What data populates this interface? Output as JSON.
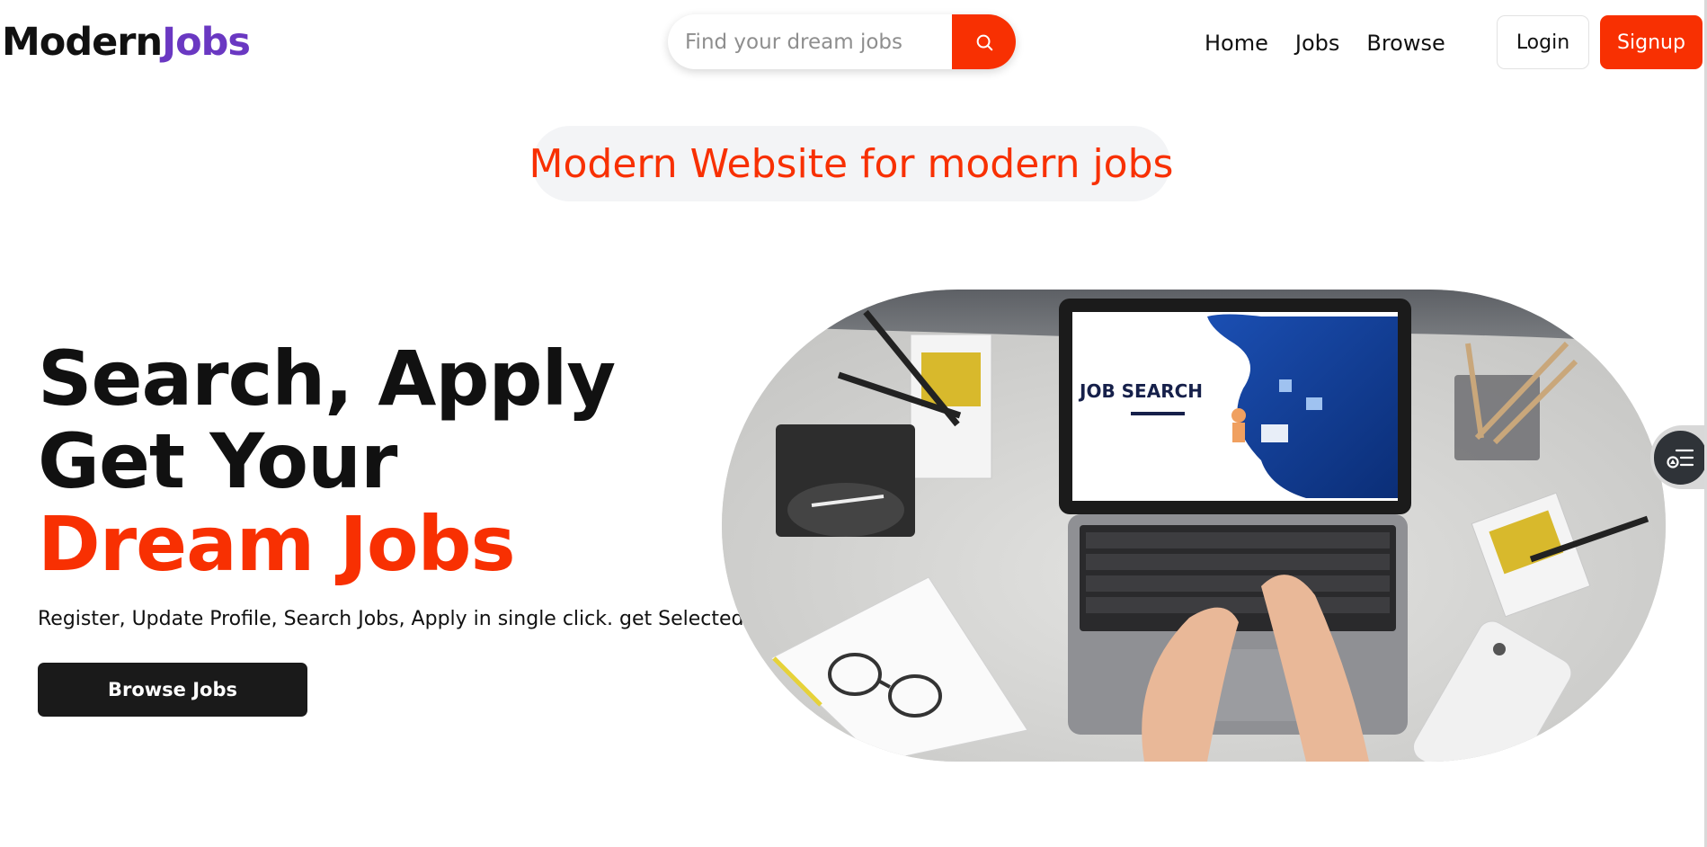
{
  "logo": {
    "part1": "Modern",
    "part2": "Jobs"
  },
  "search": {
    "placeholder": "Find your dream jobs"
  },
  "nav": {
    "home": "Home",
    "jobs": "Jobs",
    "browse": "Browse"
  },
  "auth": {
    "login": "Login",
    "signup": "Signup"
  },
  "tagline": "Modern Website for modern jobs",
  "hero": {
    "line1": "Search, Apply",
    "line2": "Get Your",
    "line3": "Dream Jobs",
    "subtitle": "Register, Update Profile, Search Jobs, Apply in single click. get Selected!!",
    "cta": "Browse Jobs",
    "image_screen_text": "JOB SEARCH"
  },
  "icons": {
    "search_button": "search-icon",
    "side_widget": "accessibility-menu-icon"
  },
  "colors": {
    "accent_red": "#f83002",
    "logo_purple": "#6a38c2",
    "cta_dark": "#1a1a1a",
    "tagline_bg": "#f3f4f6"
  }
}
